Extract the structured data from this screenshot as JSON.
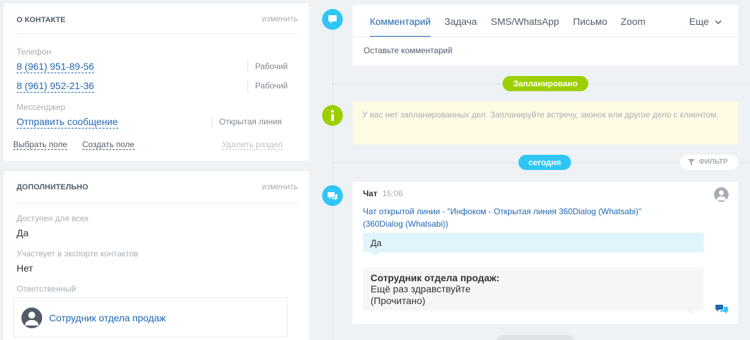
{
  "contact": {
    "title": "О КОНТАКТЕ",
    "edit": "изменить",
    "phone_label": "Телефон",
    "phones": [
      {
        "number": "8 (961) 951-89-56",
        "type": "Рабочий"
      },
      {
        "number": "8 (961) 952-21-36",
        "type": "Рабочий"
      }
    ],
    "messenger_label": "Мессенджер",
    "messenger_link": "Отправить сообщение",
    "messenger_type": "Открытая линия",
    "select_field": "Выбрать поле",
    "create_field": "Создать поле",
    "delete_section": "Удалить раздел"
  },
  "additional": {
    "title": "ДОПОЛНИТЕЛЬНО",
    "edit": "изменить",
    "fields": [
      {
        "label": "Доступен для всех",
        "value": "Да"
      },
      {
        "label": "Участвует в экспорте контактов",
        "value": "Нет"
      }
    ],
    "responsible_label": "Ответственный",
    "responsible_name": "Сотрудник отдела продаж"
  },
  "composer": {
    "tabs": [
      "Комментарий",
      "Задача",
      "SMS/WhatsApp",
      "Письмо",
      "Zoom"
    ],
    "more": "Еще",
    "placeholder": "Оставьте комментарий"
  },
  "planned": {
    "badge": "Запланировано",
    "empty_text": "У вас нет запланированных дел. Запланируйте встречу, звонок или другое дело с клиентом."
  },
  "today": {
    "badge": "сегодня",
    "filter": "ФИЛЬТР"
  },
  "chat": {
    "type": "Чат",
    "time": "15:06",
    "title": "Чат открытой линии - \"Инфоком - Открытая линия 360Dialog (Whatsabi)\" (360Dialog (Whatsabi))",
    "incoming": "Да",
    "outgoing_author": "Сотрудник отдела продаж:",
    "outgoing_text": "Ещё раз здравствуйте",
    "outgoing_status": "(Прочитано)"
  },
  "colors": {
    "accent_blue": "#2fc6f6",
    "green": "#9dcf00",
    "link": "#2067b0"
  }
}
